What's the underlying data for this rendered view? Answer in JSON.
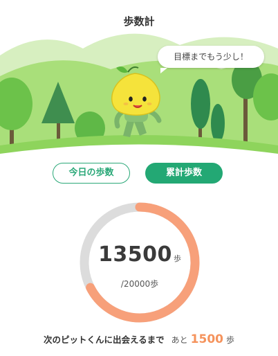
{
  "header": {
    "title": "歩数計"
  },
  "speech_bubble": {
    "text": "目標までもう少し！"
  },
  "tabs": [
    {
      "label": "今日の歩数",
      "selected": false
    },
    {
      "label": "累計歩数",
      "selected": true
    }
  ],
  "progress": {
    "current": "13500",
    "unit": "歩",
    "goal_text": "/20000歩",
    "fraction": 0.675
  },
  "footer": {
    "message": "次のピットくんに出会えるまで",
    "remaining_prefix": "あと",
    "remaining_value": "1500",
    "remaining_unit": "歩"
  },
  "colors": {
    "accent_green": "#23a874",
    "progress_orange": "#f7a07a",
    "track_gray": "#dcdcdc",
    "hill_green": "#8ed45c"
  },
  "icons": [
    "mascot-character"
  ]
}
